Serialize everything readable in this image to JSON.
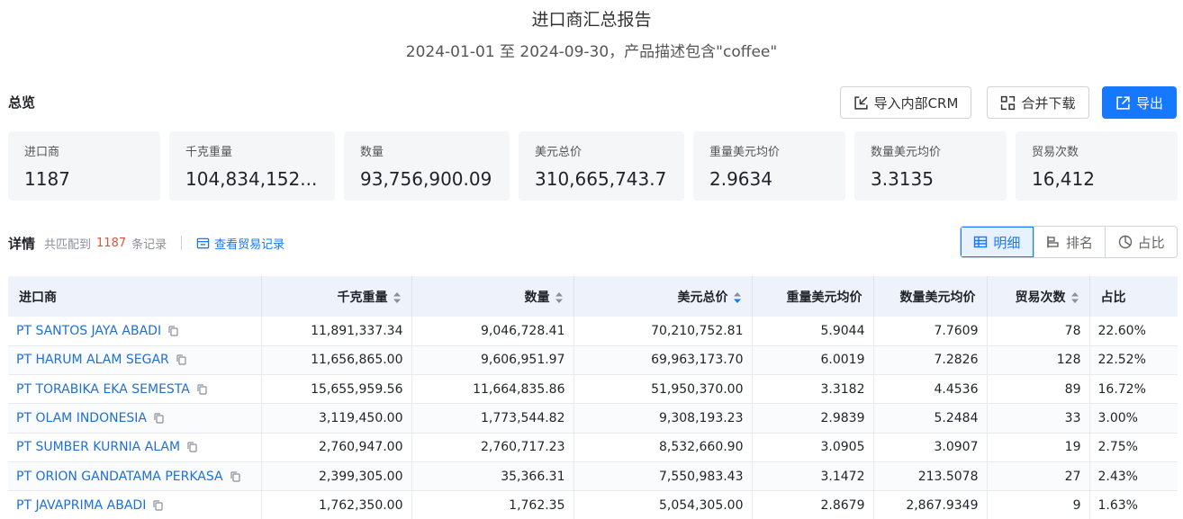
{
  "header": {
    "title": "进口商汇总报告",
    "subtitle": "2024-01-01 至 2024-09-30，产品描述包含\"coffee\""
  },
  "overview": {
    "label": "总览",
    "buttons": {
      "import_crm": "导入内部CRM",
      "merge_download": "合并下载",
      "export": "导出"
    },
    "stats": [
      {
        "label": "进口商",
        "value": "1187"
      },
      {
        "label": "千克重量",
        "value": "104,834,152..."
      },
      {
        "label": "数量",
        "value": "93,756,900.09"
      },
      {
        "label": "美元总价",
        "value": "310,665,743.7"
      },
      {
        "label": "重量美元均价",
        "value": "2.9634"
      },
      {
        "label": "数量美元均价",
        "value": "3.3135"
      },
      {
        "label": "贸易次数",
        "value": "16,412"
      }
    ]
  },
  "detail": {
    "label": "详情",
    "match_prefix": "共匹配到",
    "match_count": "1187",
    "match_suffix": "条记录",
    "view_trade_link": "查看贸易记录",
    "views": {
      "detail": "明细",
      "rank": "排名",
      "share": "占比"
    }
  },
  "table": {
    "columns": [
      "进口商",
      "千克重量",
      "数量",
      "美元总价",
      "重量美元均价",
      "数量美元均价",
      "贸易次数",
      "占比"
    ],
    "rows": [
      [
        "PT SANTOS JAYA ABADI",
        "11,891,337.34",
        "9,046,728.41",
        "70,210,752.81",
        "5.9044",
        "7.7609",
        "78",
        "22.60%"
      ],
      [
        "PT HARUM ALAM SEGAR",
        "11,656,865.00",
        "9,606,951.97",
        "69,963,173.70",
        "6.0019",
        "7.2826",
        "128",
        "22.52%"
      ],
      [
        "PT TORABIKA EKA SEMESTA",
        "15,655,959.56",
        "11,664,835.86",
        "51,950,370.00",
        "3.3182",
        "4.4536",
        "89",
        "16.72%"
      ],
      [
        "PT OLAM INDONESIA",
        "3,119,450.00",
        "1,773,544.82",
        "9,308,193.23",
        "2.9839",
        "5.2484",
        "33",
        "3.00%"
      ],
      [
        "PT SUMBER KURNIA ALAM",
        "2,760,947.00",
        "2,760,717.23",
        "8,532,660.90",
        "3.0905",
        "3.0907",
        "19",
        "2.75%"
      ],
      [
        "PT ORION GANDATAMA PERKASA",
        "2,399,305.00",
        "35,366.31",
        "7,550,983.43",
        "3.1472",
        "213.5078",
        "27",
        "2.43%"
      ],
      [
        "PT JAVAPRIMA ABADI",
        "1,762,350.00",
        "1,762.35",
        "5,054,305.00",
        "2.8679",
        "2,867.9349",
        "9",
        "1.63%"
      ]
    ]
  },
  "colors": {
    "accent": "#1677ff",
    "count": "#e0533b",
    "header_bg": "#eef2fb"
  }
}
